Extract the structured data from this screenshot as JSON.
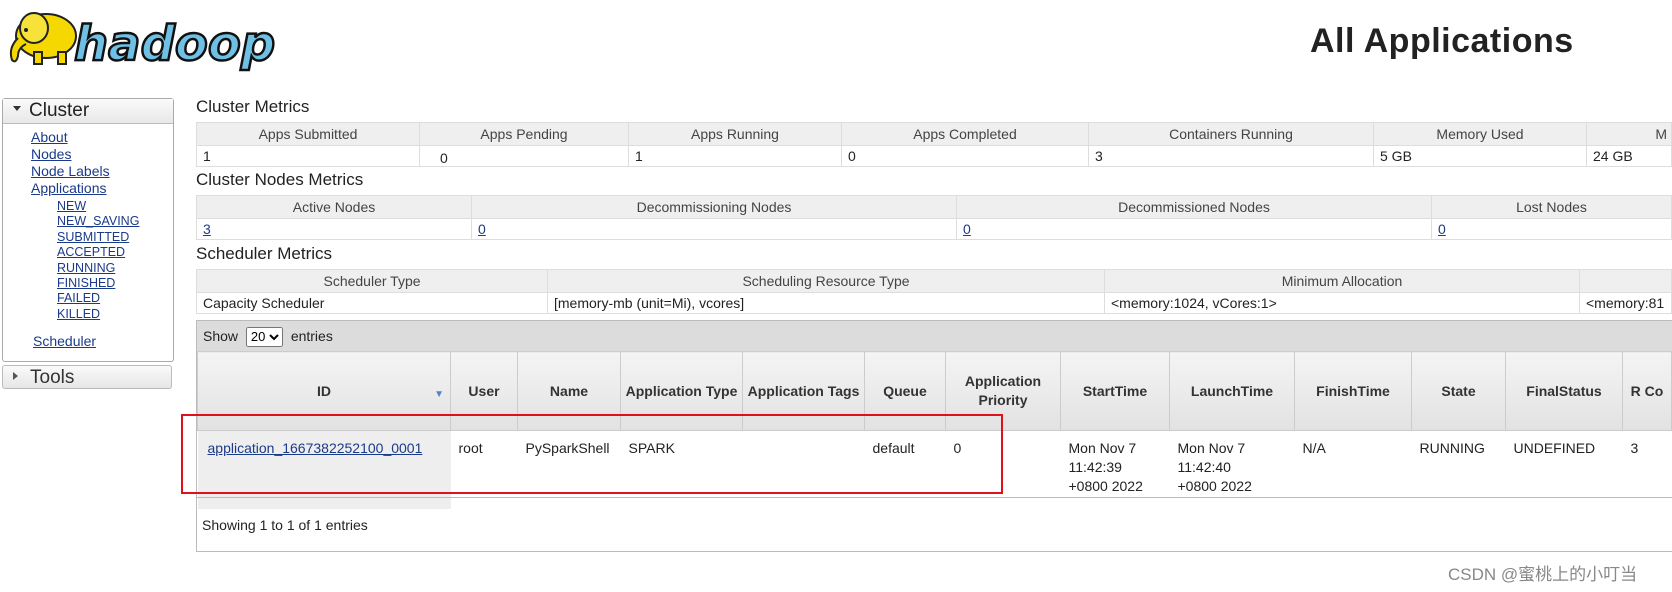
{
  "header": {
    "title": "All Applications",
    "logo_text": "hadoop"
  },
  "nav": {
    "cluster_label": "Cluster",
    "links": [
      "About",
      "Nodes",
      "Node Labels",
      "Applications"
    ],
    "app_states": [
      "NEW",
      "NEW_SAVING",
      "SUBMITTED",
      "ACCEPTED",
      "RUNNING",
      "FINISHED",
      "FAILED",
      "KILLED"
    ],
    "scheduler_label": "Scheduler",
    "tools_label": "Tools"
  },
  "cluster_metrics": {
    "title": "Cluster Metrics",
    "headers": [
      "Apps Submitted",
      "Apps Pending",
      "Apps Running",
      "Apps Completed",
      "Containers Running",
      "Memory Used",
      "M"
    ],
    "values": [
      "1",
      "0",
      "1",
      "0",
      "3",
      "5 GB",
      "24 GB"
    ]
  },
  "node_metrics": {
    "title": "Cluster Nodes Metrics",
    "headers": [
      "Active Nodes",
      "Decommissioning Nodes",
      "Decommissioned Nodes",
      "Lost Nodes"
    ],
    "values": [
      "3",
      "0",
      "0",
      "0"
    ]
  },
  "scheduler_metrics": {
    "title": "Scheduler Metrics",
    "headers": [
      "Scheduler Type",
      "Scheduling Resource Type",
      "Minimum Allocation",
      ""
    ],
    "values": [
      "Capacity Scheduler",
      "[memory-mb (unit=Mi), vcores]",
      "<memory:1024, vCores:1>",
      "<memory:81"
    ]
  },
  "apps": {
    "show_label": "Show",
    "entries_label": "entries",
    "page_size": "20",
    "columns": [
      "ID",
      "User",
      "Name",
      "Application Type",
      "Application Tags",
      "Queue",
      "Application Priority",
      "StartTime",
      "LaunchTime",
      "FinishTime",
      "State",
      "FinalStatus",
      "R Co"
    ],
    "rows": [
      {
        "id": "application_1667382252100_0001",
        "user": "root",
        "name": "PySparkShell",
        "type": "SPARK",
        "tags": "",
        "queue": "default",
        "priority": "0",
        "start_l1": "Mon Nov 7",
        "start_l2": "11:42:39",
        "start_l3": "+0800 2022",
        "launch_l1": "Mon Nov 7",
        "launch_l2": "11:42:40",
        "launch_l3": "+0800 2022",
        "finish": "N/A",
        "state": "RUNNING",
        "final_status": "UNDEFINED",
        "running": "3"
      }
    ],
    "footer": "Showing 1 to 1 of 1 entries"
  },
  "watermark": "CSDN @蜜桃上的小叮当",
  "colors": {
    "link": "#1a3a8a",
    "highlight": "#e0111a",
    "logo_yellow": "#f5d800",
    "logo_blue": "#6ec1e4"
  }
}
